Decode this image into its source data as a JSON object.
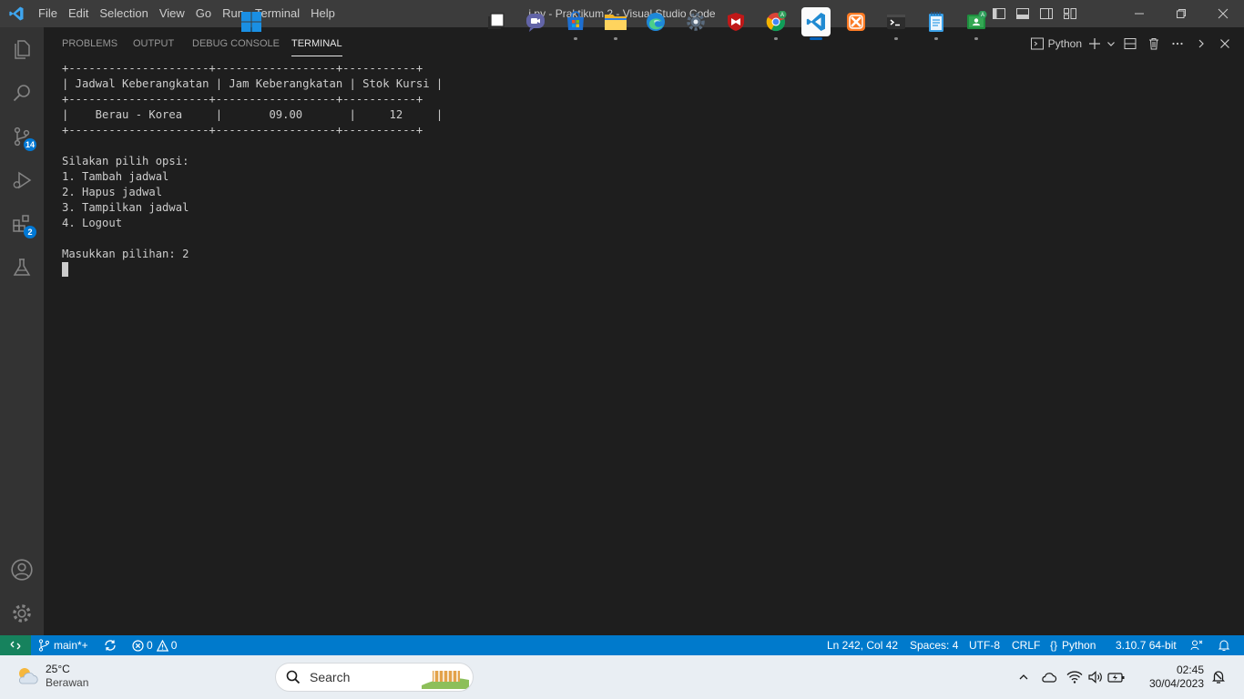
{
  "window": {
    "title": "j.py - Praktikum 2 - Visual Studio Code",
    "menu": [
      "File",
      "Edit",
      "Selection",
      "View",
      "Go",
      "Run",
      "Terminal",
      "Help"
    ]
  },
  "activity_bar": {
    "source_control_badge": "14",
    "extensions_badge": "2"
  },
  "panel": {
    "tabs": [
      "PROBLEMS",
      "OUTPUT",
      "DEBUG CONSOLE",
      "TERMINAL"
    ],
    "active_tab": "TERMINAL",
    "terminal_name": "Python"
  },
  "terminal": {
    "lines": [
      "+---------------------+------------------+-----------+",
      "| Jadwal Keberangkatan | Jam Keberangkatan | Stok Kursi |",
      "+---------------------+------------------+-----------+",
      "|    Berau - Korea     |       09.00       |     12     |",
      "+---------------------+------------------+-----------+",
      "",
      "Silakan pilih opsi:",
      "1. Tambah jadwal",
      "2. Hapus jadwal",
      "3. Tampilkan jadwal",
      "4. Logout",
      "",
      "Masukkan pilihan: 2"
    ]
  },
  "status_bar": {
    "branch": "main*+",
    "errors": "0",
    "warnings": "0",
    "cursor_position": "Ln 242, Col 42",
    "indent": "Spaces: 4",
    "encoding": "UTF-8",
    "eol": "CRLF",
    "language": "Python",
    "interpreter": "3.10.7 64-bit"
  },
  "taskbar": {
    "weather_temp": "25°C",
    "weather_desc": "Berawan",
    "search_placeholder": "Search",
    "time": "02:45",
    "date": "30/04/2023"
  },
  "colors": {
    "accent": "#007acc",
    "remote": "#16825d",
    "editor_bg": "#1e1e1e",
    "activity_bg": "#333333",
    "title_bg": "#3c3c3c"
  }
}
